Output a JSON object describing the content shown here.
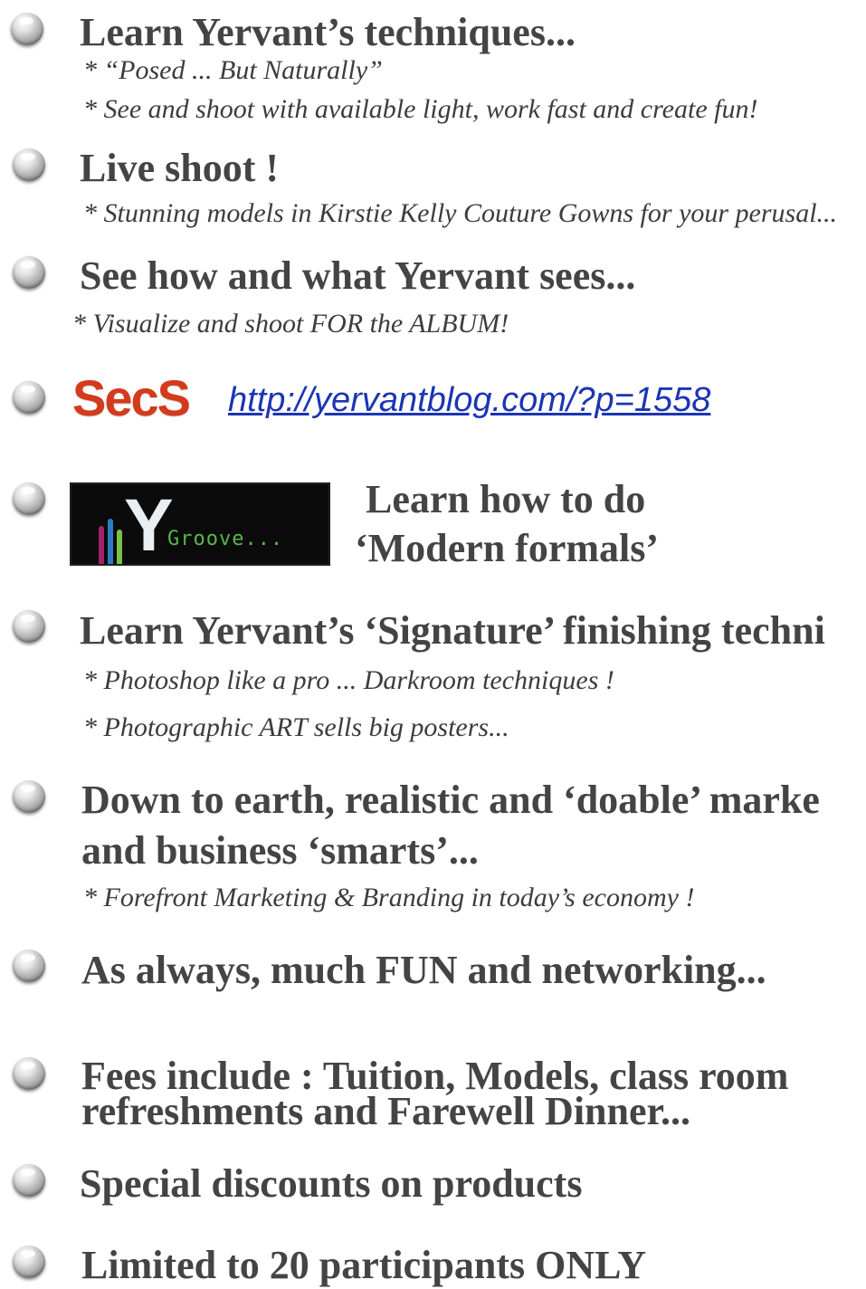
{
  "items": [
    {
      "heading": "Learn Yervant’s techniques...",
      "subs": [
        "* “Posed ... But Naturally”",
        "* See and shoot with available light, work fast and create fun!"
      ]
    },
    {
      "heading": "Live shoot !",
      "subs": [
        "* Stunning models in Kirstie Kelly Couture Gowns for your perusal..."
      ]
    },
    {
      "heading": "See how and what  Yervant sees...",
      "subs": [
        "* Visualize and shoot FOR the ALBUM!"
      ]
    },
    {
      "logo_text": "SecS",
      "link": "http://yervantblog.com/?p=1558"
    },
    {
      "logo_text": "Y",
      "logo_subtext": "Groove...",
      "heading_line1": "Learn how to do",
      "heading_line2": "‘Modern formals’"
    },
    {
      "heading": "Learn Yervant’s ‘Signature’ finishing techni",
      "subs": [
        "* Photoshop like a pro ... Darkroom techniques !",
        "* Photographic ART  sells big posters..."
      ]
    },
    {
      "heading_line1": "Down to earth, realistic and ‘doable’ marke",
      "heading_line2": "and business ‘smarts’...",
      "subs": [
        "* Forefront Marketing & Branding in today’s economy !"
      ]
    },
    {
      "heading": "As always, much FUN and networking..."
    },
    {
      "heading_line1": "Fees include : Tuition, Models, class room",
      "heading_line2": "refreshments and Farewell Dinner..."
    },
    {
      "heading": "Special discounts on products"
    },
    {
      "heading": "Limited to 20 participants ONLY"
    }
  ],
  "colors": {
    "text": "#444444",
    "link": "#1b35b5",
    "secs_logo": "#d43a1c",
    "groove_text": "#56b84a"
  }
}
